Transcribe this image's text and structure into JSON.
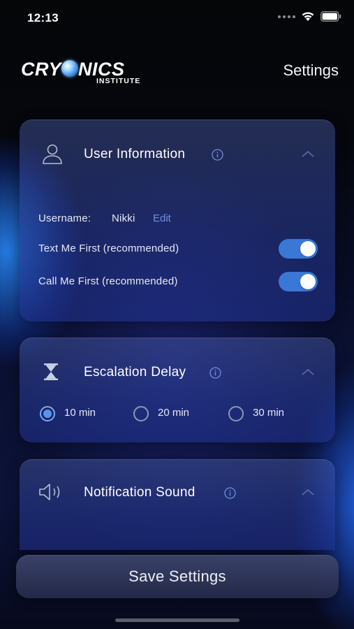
{
  "status_bar": {
    "time": "12:13",
    "icons": [
      "cellular-signal-icon",
      "wifi-icon",
      "battery-icon"
    ]
  },
  "header": {
    "logo_text_left": "CRY",
    "logo_text_right": "NICS",
    "logo_subtext": "INSTITUTE",
    "title": "Settings"
  },
  "user_information": {
    "title": "User Information",
    "username_label": "Username:",
    "username_value": "Nikki",
    "edit_label": "Edit",
    "text_me_first": {
      "label": "Text Me First (recommended)",
      "on": true
    },
    "call_me_first": {
      "label": "Call Me First (recommended)",
      "on": true
    }
  },
  "escalation_delay": {
    "title": "Escalation Delay",
    "options": [
      "10 min",
      "20 min",
      "30 min"
    ],
    "selected": "10 min"
  },
  "notification_sound": {
    "title": "Notification Sound"
  },
  "save_button": {
    "label": "Save Settings"
  },
  "colors": {
    "accent": "#3a78d6",
    "link": "#6f8fe0",
    "card": "#2e3f96"
  }
}
